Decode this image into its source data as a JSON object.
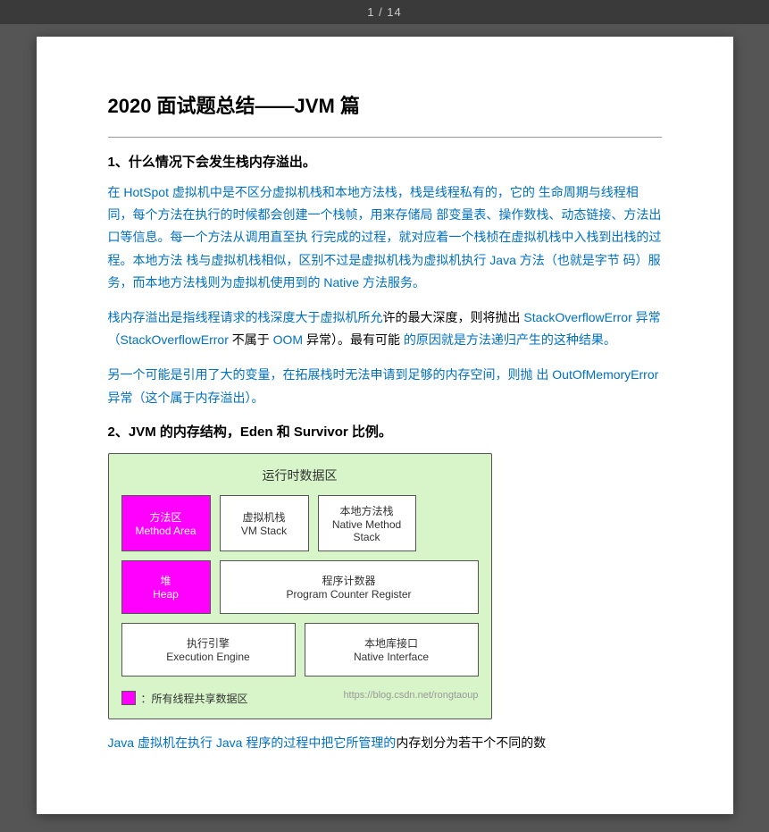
{
  "topbar": {
    "pagination": "1 / 14"
  },
  "content": {
    "main_title": "2020 面试题总结——JVM 篇",
    "section1": {
      "heading": "1、什么情况下会发生栈内存溢出。",
      "para1": "在 HotSpot 虚拟机中是不区分虚拟机栈和本地方法栈，栈是线程私有的，它的生命周期与线程相同，每个方法在执行的时候都会创建一个栈帧，用来存储局部变量表、操作数栈、动态链接、方法出口等信息。每一个方法从调用直至执行完成的过程，就对应着一个栈桢在虚拟机栈中入栈到出栈的过程。本地方法栈与虚拟机栈相似，区别不过是虚拟机栈为虚拟机执行 Java 方法（也就是字节码）服务，而本地方法栈则为虚拟机使用到的 Native 方法服务。",
      "para2": "栈内存溢出是指线程请求的栈深度大于虚拟机所允许的最大深度，则将抛出 StackOverflowError 异常（StackOverflowError 不属于 OOM 异常）。最有可能的原因就是方法递归产生的这种结果。",
      "para3": "另一个可能是引用了大的变量，在拓展栈时无法申请到足够的内存空间，则抛出 OutOfMemoryError 异常（这个属于内存溢出）。"
    },
    "section2": {
      "heading": "2、JVM 的内存结构，Eden 和 Survivor 比例。",
      "diagram": {
        "title": "运行时数据区",
        "method_area_label1": "方法区",
        "method_area_label2": "Method Area",
        "vm_stack_label1": "虚拟机栈",
        "vm_stack_label2": "VM Stack",
        "native_stack_label1": "本地方法栈",
        "native_stack_label2": "Native Method",
        "native_stack_label3": "Stack",
        "heap_label1": "堆",
        "heap_label2": "Heap",
        "counter_label1": "程序计数器",
        "counter_label2": "Program Counter Register",
        "exec_label1": "执行引擎",
        "exec_label2": "Execution Engine",
        "native_iface_label1": "本地库接口",
        "native_iface_label2": "Native Interface",
        "legend_text": "：所有线程共享数据区",
        "watermark": "https://blog.csdn.net/rongtaoup"
      }
    },
    "bottom_para": "Java 虚拟机在执行 Java 程序的过程中把它所管理的内存划分为若干个不同的数"
  }
}
